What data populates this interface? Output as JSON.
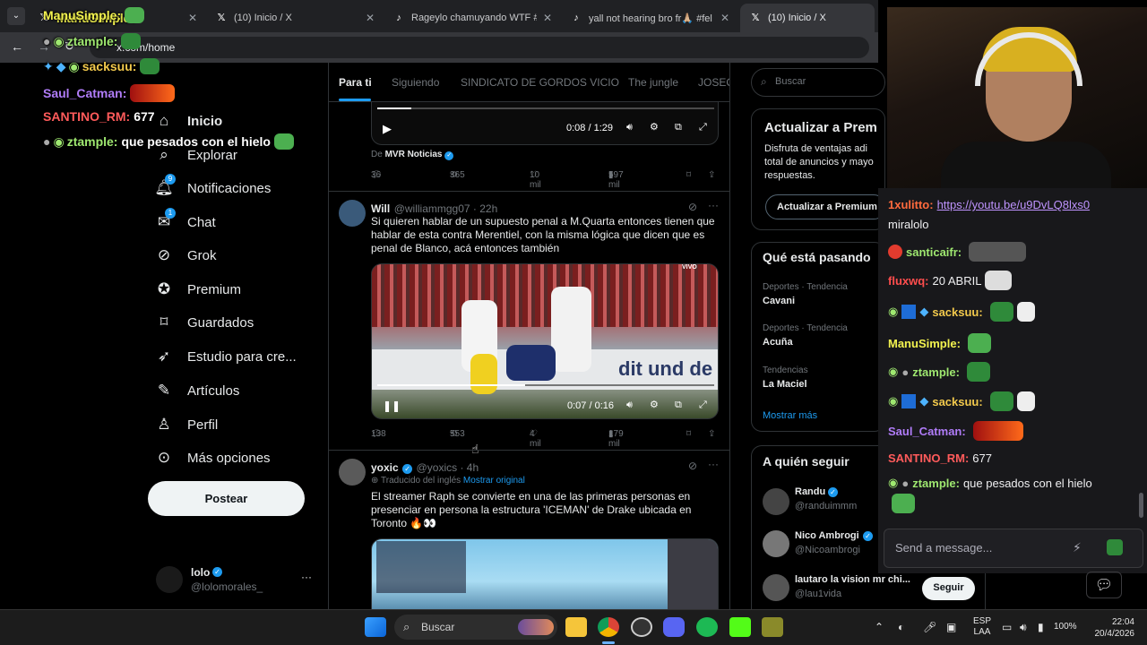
{
  "browser": {
    "tabs": [
      {
        "title": "ManuSimple:",
        "icon": "x-icon"
      },
      {
        "title": "(10) Inicio / X",
        "icon": "x-icon"
      },
      {
        "title": "Rageylo chamuyando WTF #rag",
        "icon": "tiktok-icon"
      },
      {
        "title": "yall not hearing bro fr🙏🏼 #fel",
        "icon": "tiktok-icon"
      },
      {
        "title": "(10) Inicio / X",
        "icon": "x-icon"
      }
    ],
    "url": "x.com/home"
  },
  "overlay_chat": [
    {
      "user": "ManuSimple:",
      "color": "#f2f24f",
      "text": ""
    },
    {
      "user": "ztample:",
      "color": "#9fe870",
      "text": ""
    },
    {
      "user": "sacksuu:",
      "color": "#f2c94c",
      "text": ""
    },
    {
      "user": "Saul_Catman:",
      "color": "#b07cf8",
      "text": ""
    },
    {
      "user": "SANTINO_RM:",
      "color": "#ff5b5b",
      "text": "677"
    },
    {
      "user": "ztample:",
      "color": "#9fe870",
      "text": "que pesados con el hielo"
    }
  ],
  "sidebar": {
    "items": [
      {
        "label": "Inicio",
        "icon": "home-icon"
      },
      {
        "label": "Explorar",
        "icon": "search-icon"
      },
      {
        "label": "Notificaciones",
        "icon": "bell-icon",
        "badge": "9"
      },
      {
        "label": "Chat",
        "icon": "chat-icon",
        "badge": "1"
      },
      {
        "label": "Grok",
        "icon": "grok-icon"
      },
      {
        "label": "Premium",
        "icon": "premium-icon"
      },
      {
        "label": "Guardados",
        "icon": "bookmark-icon"
      },
      {
        "label": "Estudio para cre...",
        "icon": "rocket-icon"
      },
      {
        "label": "Artículos",
        "icon": "article-icon"
      },
      {
        "label": "Perfil",
        "icon": "person-icon"
      },
      {
        "label": "Más opciones",
        "icon": "more-icon"
      }
    ],
    "post_label": "Postear",
    "account": {
      "name": "lolo",
      "handle": "@lolomorales_",
      "more": "···"
    }
  },
  "feed": {
    "tabs": [
      "Para ti",
      "Siguiendo",
      "SINDICATO DE GORDOS VICIO",
      "The jungle",
      "JOSEO"
    ],
    "tweet0": {
      "video_time": "0:08 / 1:29",
      "source_prefix": "De",
      "source": "MVR Noticias",
      "replies": "36",
      "retweets": "365",
      "likes": "10 mil",
      "views": "597 mil"
    },
    "tweet1": {
      "name": "Will",
      "handle": "@williammgg07 · 22h",
      "text": "Si quieren hablar de un supuesto penal a M.Quarta entonces tienen que hablar de esta contra Merentiel, con la misma lógica que dicen que es penal de Blanco, acá entonces también",
      "video_badge": "VIVO",
      "video_time": "0:07 / 0:16",
      "video_bg_text": "dit und de",
      "replies": "138",
      "retweets": "553",
      "likes": "4 mil",
      "views": "179 mil"
    },
    "tweet2": {
      "name": "yoxic",
      "handle": "@yoxics · 4h",
      "translated": "Traducido del inglés",
      "show_original": "Mostrar original",
      "text": "El streamer Raph se convierte en una de las primeras personas en presenciar en persona la estructura 'ICEMAN' de Drake ubicada en Toronto 🔥👀"
    }
  },
  "right": {
    "search_placeholder": "Buscar",
    "premium": {
      "title": "Actualizar a Prem",
      "desc": "Disfruta de ventajas adi total de anuncios y mayo respuestas.",
      "button": "Actualizar a Premium"
    },
    "trends": {
      "title": "Qué está pasando",
      "items": [
        {
          "meta": "Deportes · Tendencia",
          "name": "Cavani"
        },
        {
          "meta": "Deportes · Tendencia",
          "name": "Acuña"
        },
        {
          "meta": "Tendencias",
          "name": "La Maciel"
        }
      ],
      "more": "Mostrar más"
    },
    "follow": {
      "title": "A quién seguir",
      "items": [
        {
          "name": "Randu",
          "handle": "@randuimmm"
        },
        {
          "name": "Nico Ambrogi",
          "handle": "@Nicoambrogi"
        },
        {
          "name": "lautaro la vision mr chi...",
          "handle": "@lau1vida"
        }
      ],
      "follow_label": "Seguir"
    }
  },
  "chat": {
    "messages": [
      {
        "user": "1xulitto:",
        "color": "#ff6a3d",
        "text": "https://youtu.be/u9DvLQ8lxs0",
        "link": true
      },
      {
        "user": "",
        "color": "#efeff1",
        "text": "miralolo"
      },
      {
        "user": "santicaifr:",
        "color": "#9fe870",
        "text": ""
      },
      {
        "user": "fluxwq:",
        "color": "#ff4d4d",
        "text": "20 ABRIL"
      },
      {
        "user": "sacksuu:",
        "color": "#f2c94c",
        "text": ""
      },
      {
        "user": "ManuSimple:",
        "color": "#f2f24f",
        "text": ""
      },
      {
        "user": "ztample:",
        "color": "#9fe870",
        "text": ""
      },
      {
        "user": "sacksuu:",
        "color": "#f2c94c",
        "text": ""
      },
      {
        "user": "Saul_Catman:",
        "color": "#b07cf8",
        "text": ""
      },
      {
        "user": "SANTINO_RM:",
        "color": "#ff5b5b",
        "text": "677"
      },
      {
        "user": "ztample:",
        "color": "#9fe870",
        "text": "que pesados con el hielo"
      }
    ],
    "input_placeholder": "Send a message..."
  },
  "taskbar": {
    "search_label": "Buscar",
    "lang": "ESP",
    "lang2": "LAA",
    "battery": "100%",
    "time": "22:04",
    "date": "20/4/2026"
  }
}
